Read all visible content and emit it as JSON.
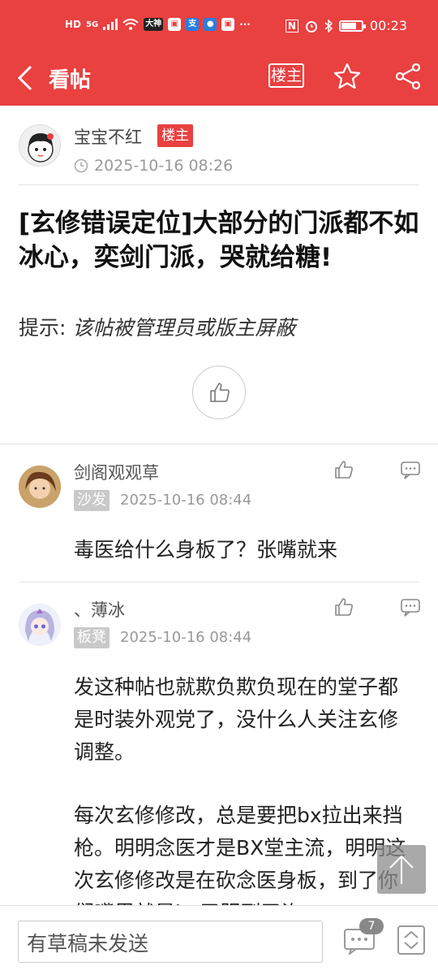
{
  "status_bar": {
    "left_text_1": "HD",
    "left_text_2": "5G",
    "chip_app_1": "大神",
    "chip_app_2": "支",
    "more": "···",
    "nfc": "N",
    "time": "00:23"
  },
  "header": {
    "title": "看帖",
    "owner_button": "楼主"
  },
  "post": {
    "author": "宝宝不红",
    "owner_tag": "楼主",
    "time": "2025-10-16 08:26",
    "title": "[玄修错误定位]大部分的门派都不如冰心，奕剑门派，哭就给糖!",
    "hint_label": "提示: ",
    "hint_text": "该帖被管理员或版主屏蔽"
  },
  "comments": [
    {
      "author": "剑阁观观草",
      "floor": "沙发",
      "time": "2025-10-16 08:44",
      "text": "毒医给什么身板了？张嘴就来"
    },
    {
      "author": "、薄冰",
      "floor": "板凳",
      "time": "2025-10-16 08:44",
      "text_p1": "发这种帖也就欺负欺负现在的堂子都是时装外观党了，没什么人关注玄修调整。",
      "text_p2": "每次玄修修改，总是要把bx拉出来挡枪。明明念医才是BX堂主流，明明这次玄修修改是在砍念医身板，到了你们嘴里就是bx又阴到了诈"
    }
  ],
  "bottom": {
    "input_placeholder": "有草稿未发送",
    "comment_count": "7"
  },
  "colors": {
    "brand_red": "#e94040"
  }
}
